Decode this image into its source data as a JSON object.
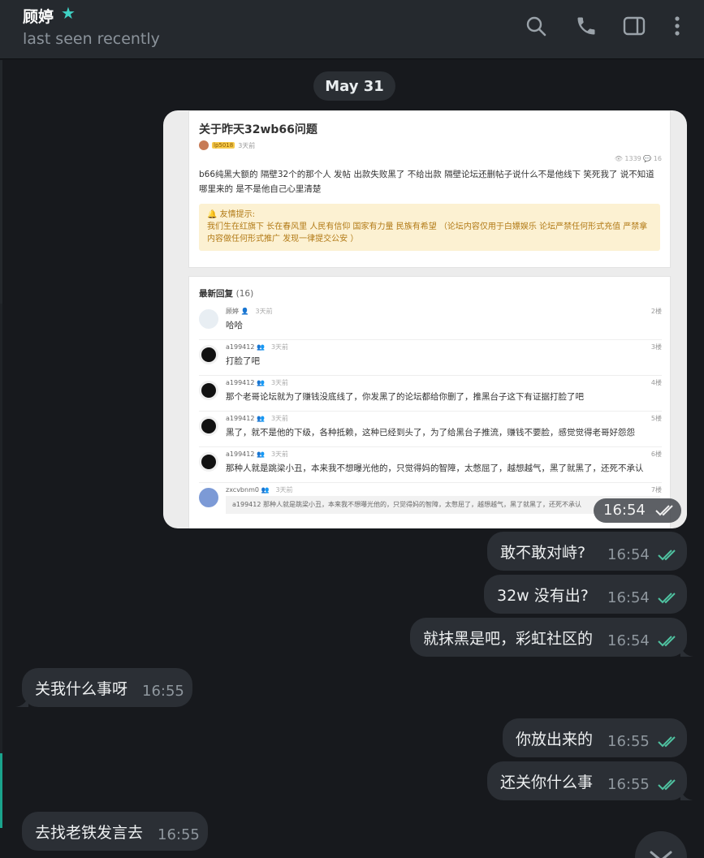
{
  "header": {
    "name": "顾婷",
    "status": "last seen recently",
    "icons": [
      "search-icon",
      "phone-icon",
      "sidebar-toggle-icon",
      "more-vertical-icon"
    ]
  },
  "date_divider": "May 31",
  "photo_message": {
    "time": "16:54",
    "post": {
      "title": "关于昨天32wb66问题",
      "author_badge": "lp5018",
      "posted_ago": "3天前",
      "stats": "👁 1339  💬 16",
      "body": "b66纯黑大额的 隔壁32个的那个人 发帖 出款失败黑了 不给出款 隔壁论坛还删帖子说什么不是他线下 笑死我了 说不知道哪里来的 是不是他自己心里清楚",
      "notice_title": "🔔 友情提示:",
      "notice_body": "我们生在红旗下 长在春风里 人民有信仰 国家有力量 民族有希望 （论坛内容仅用于白嫖娱乐 论坛严禁任何形式充值 严禁拿内容做任何形式推广 发现一律提交公安 ）"
    },
    "replies_header": "最新回复",
    "replies_count": "(16)",
    "replies": [
      {
        "user": "顾婷 👤",
        "ago": "3天前",
        "floor": "2楼",
        "text": "哈哈"
      },
      {
        "user": "a199412 👥",
        "ago": "3天前",
        "floor": "3楼",
        "text": "打脸了吧"
      },
      {
        "user": "a199412 👥",
        "ago": "3天前",
        "floor": "4楼",
        "text": "那个老哥论坛就为了赚钱没底线了，你发黑了的论坛都给你删了，推黑台子这下有证据打脸了吧"
      },
      {
        "user": "a199412 👥",
        "ago": "3天前",
        "floor": "5楼",
        "text": "黑了，就不是他的下级，各种抵赖，这种已经到头了，为了给黑台子推流，赚钱不要脸，感觉觉得老哥好怨怨"
      },
      {
        "user": "a199412 👥",
        "ago": "3天前",
        "floor": "6楼",
        "text": "那种人就是跳梁小丑，本来我不想曝光他的，只觉得妈的智障，太憋屈了，越想越气，黑了就黑了，还死不承认"
      },
      {
        "user": "zxcvbnm0 👥",
        "ago": "3天前",
        "floor": "7楼",
        "quote": "a199412   那种人就是跳梁小丑，本来我不想曝光他的，只觉得妈的智障，太憋屈了，越想越气，黑了就黑了，还死不承认"
      }
    ]
  },
  "messages": [
    {
      "dir": "out",
      "text": "敢不敢对峙?",
      "time": "16:54"
    },
    {
      "dir": "out",
      "text": "32w 没有出?",
      "time": "16:54"
    },
    {
      "dir": "out",
      "text": "就抹黑是吧，彩虹社区的",
      "time": "16:54"
    },
    {
      "dir": "in",
      "text": "关我什么事呀",
      "time": "16:55"
    },
    {
      "dir": "out",
      "text": "你放出来的",
      "time": "16:55"
    },
    {
      "dir": "out",
      "text": "还关你什么事",
      "time": "16:55"
    },
    {
      "dir": "in",
      "text": "去找老铁发言去",
      "time": "16:55"
    }
  ],
  "colors": {
    "accent": "#3fd1c4",
    "read_check": "#4fc3a1",
    "bubble": "#2b2f35",
    "background": "#17191d"
  }
}
